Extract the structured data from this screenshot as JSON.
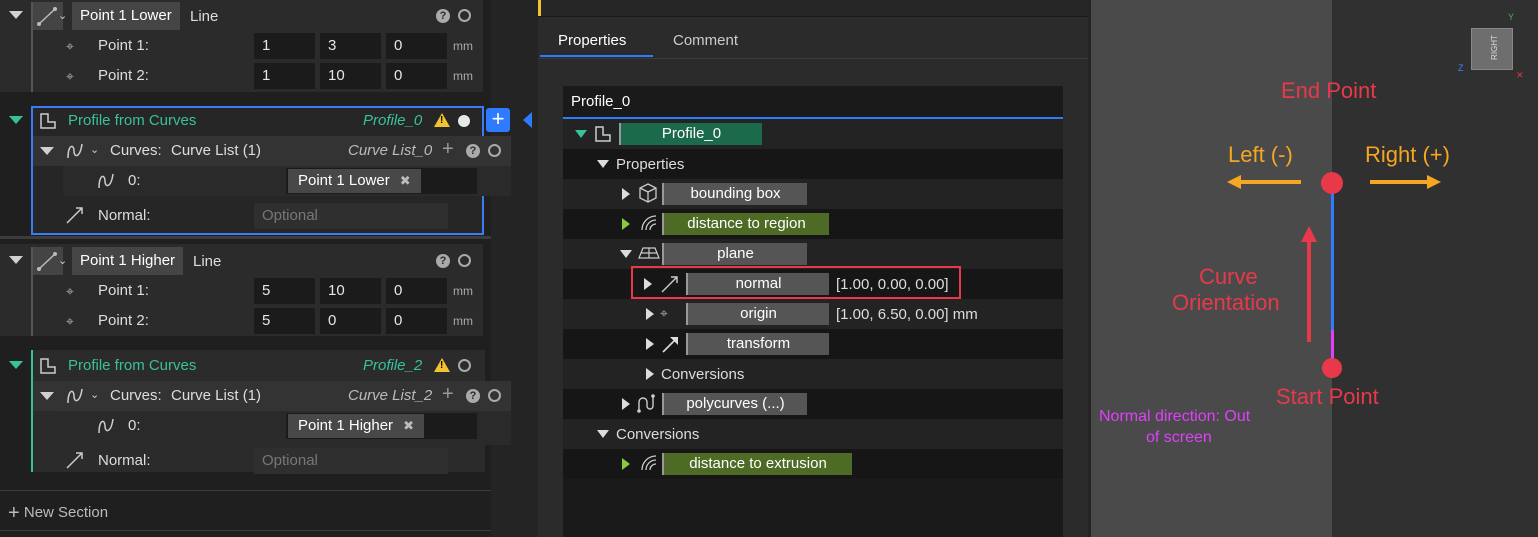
{
  "left_panel": {
    "section1": {
      "name": "Point 1 Lower",
      "type": "Line",
      "rows": [
        {
          "label": "Point 1:",
          "values": [
            "1",
            "3",
            "0"
          ],
          "unit": "mm"
        },
        {
          "label": "Point 2:",
          "values": [
            "1",
            "10",
            "0"
          ],
          "unit": "mm"
        }
      ]
    },
    "section2": {
      "title": "Profile from Curves",
      "output": "Profile_0",
      "curves_label": "Curves:",
      "curves_value": "Curve List (1)",
      "curves_output": "Curve List_0",
      "item_index": "0:",
      "item_chip": "Point 1 Lower",
      "normal_label": "Normal:",
      "normal_placeholder": "Optional"
    },
    "section3": {
      "name": "Point 1 Higher",
      "type": "Line",
      "rows": [
        {
          "label": "Point 1:",
          "values": [
            "5",
            "10",
            "0"
          ],
          "unit": "mm"
        },
        {
          "label": "Point 2:",
          "values": [
            "5",
            "0",
            "0"
          ],
          "unit": "mm"
        }
      ]
    },
    "section4": {
      "title": "Profile from Curves",
      "output": "Profile_2",
      "curves_label": "Curves:",
      "curves_value": "Curve List (1)",
      "curves_output": "Curve List_2",
      "item_index": "0:",
      "item_chip": "Point 1 Higher",
      "normal_label": "Normal:",
      "normal_placeholder": "Optional"
    },
    "new_section": "New Section",
    "add_button": "+"
  },
  "properties_panel": {
    "tabs": [
      "Properties",
      "Comment"
    ],
    "active_tab": "Properties",
    "header": "Profile_0",
    "tree": {
      "root": "Profile_0",
      "properties": "Properties",
      "bounding_box": "bounding box",
      "distance_to_region": "distance to region",
      "plane": "plane",
      "normal": "normal",
      "normal_value": "[1.00, 0.00, 0.00]",
      "origin": "origin",
      "origin_value": "[1.00, 6.50, 0.00] mm",
      "transform": "transform",
      "inner_conversions": "Conversions",
      "polycurves": "polycurves (...)",
      "conversions": "Conversions",
      "distance_to_extrusion": "distance to extrusion"
    }
  },
  "viewport": {
    "end_point": "End Point",
    "left_minus": "Left (-)",
    "right_plus": "Right (+)",
    "curve_orientation_1": "Curve",
    "curve_orientation_2": "Orientation",
    "start_point": "Start Point",
    "normal_direction_1": "Normal direction: Out",
    "normal_direction_2": "of screen",
    "view_cube_label": "RIGHT",
    "axis_y": "Y",
    "axis_z": "Z",
    "colors": {
      "annotation_red": "#e8394a",
      "annotation_orange": "#f5a623",
      "normal_magenta": "#e040fb",
      "curve_blue": "#2f7bff"
    }
  }
}
